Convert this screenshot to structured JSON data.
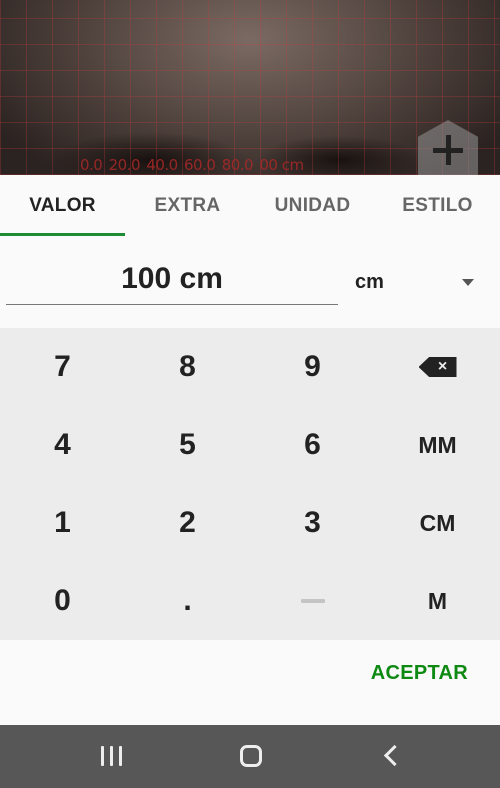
{
  "camera": {
    "ruler_marks": [
      "0.0",
      "20.0",
      "40.0",
      "60.0",
      "80.0",
      "00 cm"
    ]
  },
  "tabs": [
    {
      "label": "VALOR",
      "active": true
    },
    {
      "label": "EXTRA",
      "active": false
    },
    {
      "label": "UNIDAD",
      "active": false
    },
    {
      "label": "ESTILO",
      "active": false
    }
  ],
  "value_input": {
    "value": "100 cm"
  },
  "unit_select": {
    "selected": "cm"
  },
  "keypad": {
    "row1": [
      "7",
      "8",
      "9"
    ],
    "row2": [
      "4",
      "5",
      "6",
      "MM"
    ],
    "row3": [
      "1",
      "2",
      "3",
      "CM"
    ],
    "row4": [
      "0",
      ".",
      "M"
    ]
  },
  "footer": {
    "accept_label": "ACEPTAR"
  },
  "colors": {
    "accent": "#1e8c33",
    "accept": "#0e8a12",
    "grid_line": "#c83c3c"
  }
}
